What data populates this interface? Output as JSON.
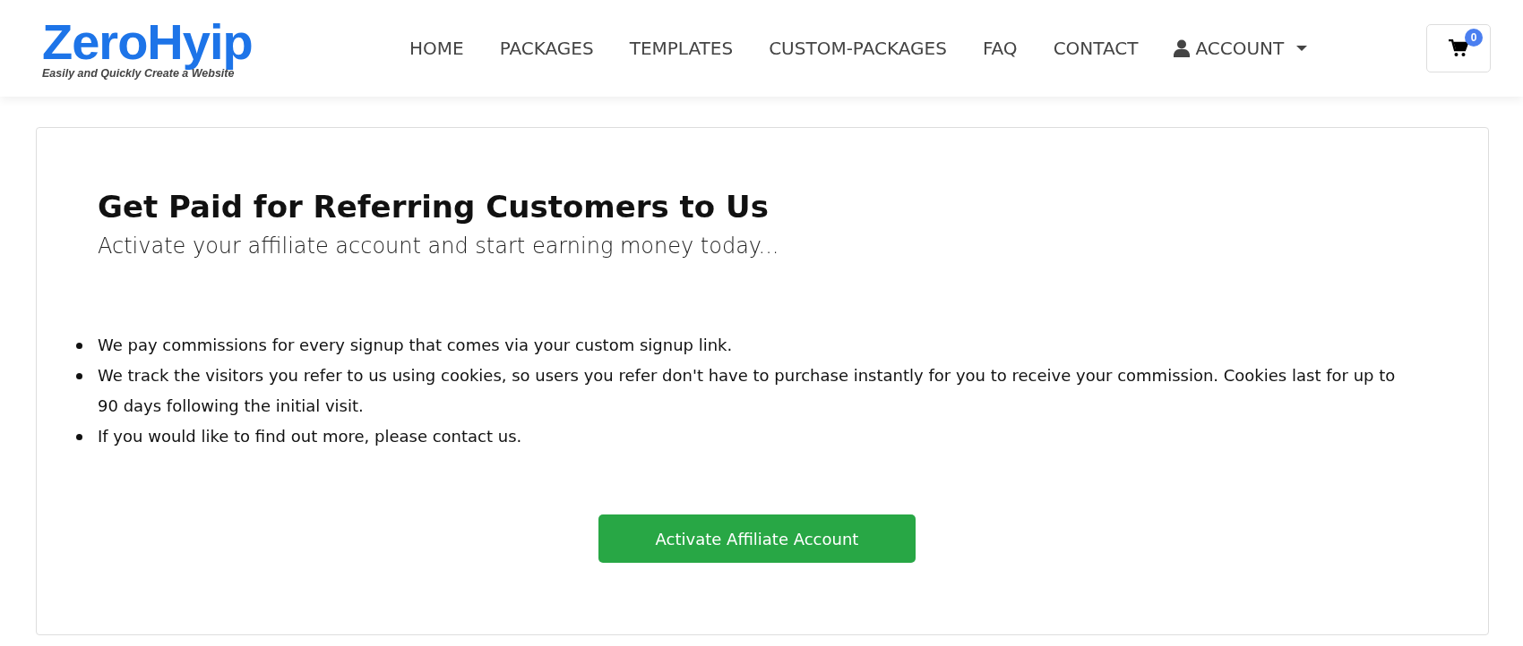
{
  "logo": {
    "name": "ZeroHyip",
    "tagline": "Easily and Quickly Create a Website"
  },
  "nav": [
    {
      "label": "HOME"
    },
    {
      "label": "PACKAGES"
    },
    {
      "label": "TEMPLATES"
    },
    {
      "label": "CUSTOM-PACKAGES"
    },
    {
      "label": "FAQ"
    },
    {
      "label": "CONTACT"
    },
    {
      "label": "ACCOUNT",
      "kind": "dropdown"
    }
  ],
  "cart": {
    "count": "0"
  },
  "main": {
    "title": "Get Paid for Referring Customers to Us",
    "subtitle": "Activate your affiliate account and start earning money today...",
    "points": [
      "We pay commissions for every signup that comes via your custom signup link.",
      "We track the visitors you refer to us using cookies, so users you refer don't have to purchase instantly for you to receive your commission. Cookies last for up to 90 days following the initial visit.",
      "If you would like to find out more, please contact us."
    ],
    "button": "Activate Affiliate Account"
  }
}
